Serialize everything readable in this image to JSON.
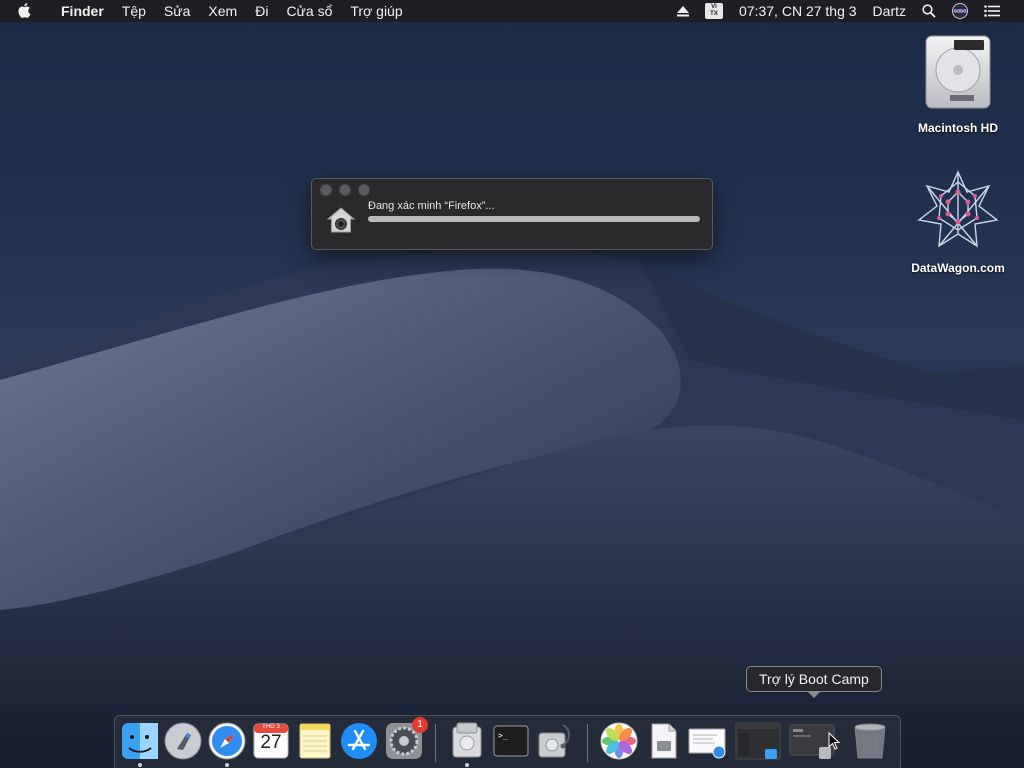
{
  "menubar": {
    "app_name": "Finder",
    "menus": [
      "Tệp",
      "Sửa",
      "Xem",
      "Đi",
      "Cửa sổ",
      "Trợ giúp"
    ],
    "input_source_top": "VI",
    "input_source_bottom": "TX",
    "clock": "07:37, CN 27 thg 3",
    "user": "Dartz",
    "icons": [
      "apple-icon",
      "eject-icon",
      "input-source-icon",
      "spotlight-icon",
      "siri-icon",
      "notification-center-icon"
    ]
  },
  "desktop": {
    "items": [
      {
        "label": "Macintosh HD",
        "icon": "hard-drive-icon"
      },
      {
        "label": "DataWagon.com",
        "icon": "datawagon-logo-icon"
      }
    ]
  },
  "progress_window": {
    "message": "Đang xác minh “Firefox”...",
    "progress": 1.0,
    "icon": "gatekeeper-icon"
  },
  "tooltip": {
    "text": "Trợ lý Boot Camp"
  },
  "dock": {
    "calendar": {
      "month": "THG 3",
      "day": "27"
    },
    "system_preferences_badge": "1",
    "apps": [
      "finder-icon",
      "launchpad-icon",
      "safari-icon",
      "calendar-icon",
      "notes-icon",
      "app-store-icon",
      "system-preferences-icon",
      "hard-drive-utility-icon",
      "terminal-icon",
      "disk-utility-icon",
      "photos-icon",
      "preview-file-icon",
      "mail-document-icon",
      "finder-window-icon",
      "boot-camp-window-icon",
      "trash-icon"
    ]
  },
  "colors": {
    "menubar_bg": "#1e1e22",
    "window_bg": "#2a2a2c",
    "badge_red": "#e23a30"
  }
}
